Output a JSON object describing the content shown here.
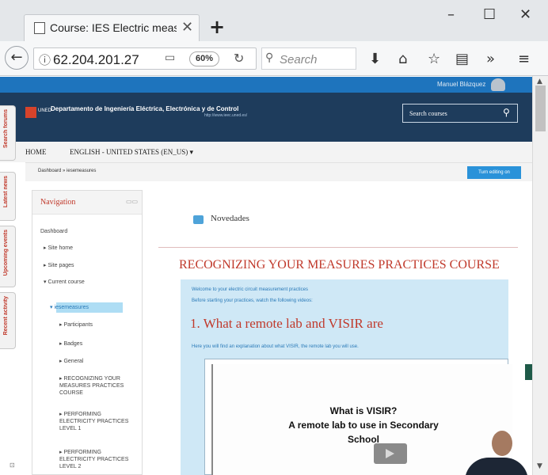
{
  "browser": {
    "tab_title": "Course: IES Electric measures",
    "new_tab": "+",
    "tab_close": "✕",
    "window_controls": {
      "minimize": "–",
      "maximize": "☐",
      "close": "✕"
    },
    "url": "62.204.201.27",
    "zoom": "60%",
    "search_placeholder": "Search",
    "toolbar_icons": [
      "download-icon",
      "home-icon",
      "star-icon",
      "reading-list-icon",
      "overflow-icon",
      "menu-icon"
    ]
  },
  "site": {
    "user_name": "Manuel Blázquez",
    "department": "Departamento de Ingeniería Eléctrica, Electrónica y de Control",
    "department_url": "http://www.ieec.uned.es/",
    "logo_text": "UNED",
    "course_search_placeholder": "Search courses",
    "menu_home": "HOME",
    "menu_language": "ENGLISH - UNITED STATES (EN_US) ▾",
    "breadcrumb": "Dashboard  »  iesemeasures",
    "edit_button": "Turn editing on"
  },
  "side_tabs": [
    "Search forums",
    "Latest news",
    "Upcoming events",
    "Recent activity"
  ],
  "navigation": {
    "title": "Navigation",
    "items": [
      {
        "label": "Dashboard",
        "indent": 0
      },
      {
        "label": "▸  Site home",
        "indent": 1
      },
      {
        "label": "▸  Site pages",
        "indent": 1
      },
      {
        "label": "▾  Current course",
        "indent": 1
      },
      {
        "label": "▾  iesemeasures",
        "indent": 2
      },
      {
        "label": "▸  Participants",
        "indent": 3
      },
      {
        "label": "▸  Badges",
        "indent": 3
      },
      {
        "label": "▸  General",
        "indent": 3
      },
      {
        "label": "▸  RECOGNIZING YOUR MEASURES PRACTICES COURSE",
        "indent": 3
      },
      {
        "label": "▸  PERFORMING ELECTRICITY PRACTICES LEVEL 1",
        "indent": 3
      },
      {
        "label": "▸  PERFORMING ELECTRICITY PRACTICES LEVEL 2",
        "indent": 3
      }
    ]
  },
  "main": {
    "news_title": "Novedades",
    "course_heading": "RECOGNIZING YOUR MEASURES PRACTICES COURSE",
    "welcome": "Welcome to your electric circuit measurement practices",
    "before": "Before starting your practices, watch the following videos:",
    "section_heading": "1. What a remote lab and VISIR are",
    "section_text": "Here you will find an explanation about what VISIR, the remote lab you will use.",
    "video_lines": [
      "What is VISIR?",
      "A remote lab to use in Secondary",
      "School"
    ]
  }
}
